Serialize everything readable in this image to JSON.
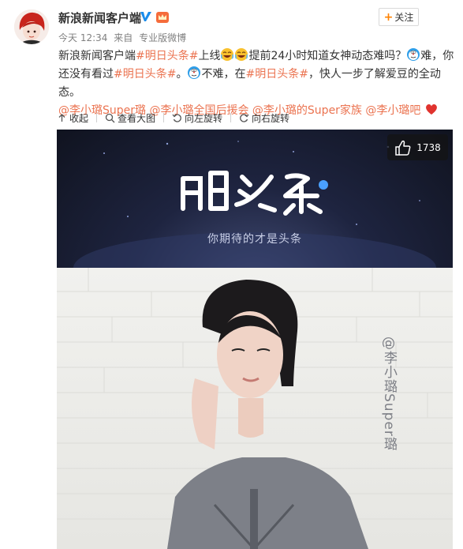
{
  "post": {
    "author": "新浪新闻客户端",
    "meta": {
      "time": "今天 12:34",
      "source_prefix": "来自",
      "source": "专业版微博"
    },
    "follow_label": "关注",
    "content": {
      "line1": {
        "t1": "新浪新闻客户端",
        "topic1": "#明日头条#",
        "t2": "上线",
        "t3": "提前24小时知道女神动态难吗？",
        "t4": "难，你"
      },
      "line2": {
        "t1": "还没有看过",
        "topic2": "#明日头条#",
        "t2": "。",
        "t3": "不难，在",
        "topic3": "#明日头条#",
        "t4": "，快人一步了解爱豆的全动态。"
      },
      "mentions": [
        "@李小璐Super璐",
        "@李小璐全国后援会",
        "@李小璐的Super家族",
        "@李小璐吧"
      ]
    }
  },
  "toolbar": {
    "collapse": "收起",
    "view_large": "查看大图",
    "rotate_left": "向左旋转",
    "rotate_right": "向右旋转"
  },
  "media": {
    "logo_text": "明日头条",
    "slogan": "你期待的才是头条",
    "watermark": "@李小璐Super璐",
    "like_count": "1738"
  },
  "colors": {
    "link": "#eb7350",
    "follow_plus": "#ff8200",
    "verified": "#1a8ceb"
  },
  "icons": [
    "avatar",
    "verified-icon",
    "crown-icon",
    "plus-icon",
    "emoji-laugh-icon",
    "emoji-doraemon-icon",
    "heart-icon",
    "collapse-icon",
    "search-icon",
    "rotate-left-icon",
    "rotate-right-icon",
    "thumbs-up-icon"
  ]
}
